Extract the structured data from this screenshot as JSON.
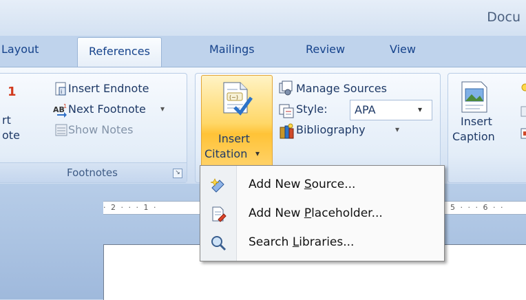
{
  "window": {
    "title": "Docu"
  },
  "tabs": [
    {
      "label": "Layout",
      "active": false
    },
    {
      "label": "References",
      "active": true
    },
    {
      "label": "Mailings",
      "active": false
    },
    {
      "label": "Review",
      "active": false
    },
    {
      "label": "View",
      "active": false
    }
  ],
  "footnotes_group": {
    "label": "Footnotes",
    "insert_footnote_partial": {
      "line1": "rt",
      "line2": "ote"
    },
    "insert_endnote": "Insert Endnote",
    "next_footnote": "Next Footnote",
    "show_notes": "Show Notes"
  },
  "citations_group": {
    "insert_citation": {
      "line1": "Insert",
      "line2": "Citation"
    },
    "manage_sources": "Manage Sources",
    "style_label": "Style:",
    "style_value": "APA",
    "bibliography": "Bibliography"
  },
  "captions_group": {
    "insert_caption": {
      "line1": "Insert",
      "line2": "Caption"
    }
  },
  "ruler": {
    "left_marks": "· 2 · · · 1 ·",
    "right_marks": "5 · · · 6 · ·"
  },
  "citation_menu": {
    "items": [
      {
        "label": "Add New Source...",
        "accel": "S",
        "icon": "add-source-icon"
      },
      {
        "label": "Add New Placeholder...",
        "accel": "P",
        "icon": "add-placeholder-icon"
      },
      {
        "label": "Search Libraries...",
        "accel": "L",
        "icon": "search-libraries-icon"
      }
    ]
  },
  "colors": {
    "accent": "#15428b",
    "highlight": "#ffc337",
    "ribbon": "#dbe7f5"
  }
}
